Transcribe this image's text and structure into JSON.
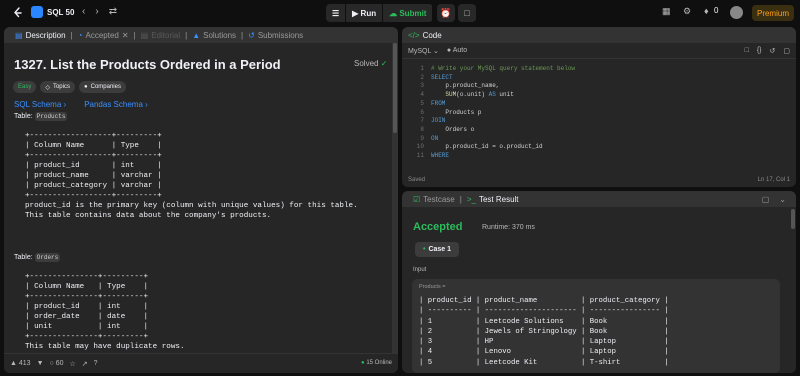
{
  "topbar": {
    "problem_list_label": "SQL 50",
    "run_label": "Run",
    "submit_label": "Submit",
    "streak_count": "0",
    "premium_label": "Premium"
  },
  "left_panel": {
    "tabs": [
      {
        "label": "Description"
      },
      {
        "label": "Accepted"
      },
      {
        "label": "Editorial"
      },
      {
        "label": "Solutions"
      },
      {
        "label": "Submissions"
      }
    ],
    "title": "1327. List the Products Ordered in a Period",
    "solved_label": "Solved",
    "chips": {
      "difficulty": "Easy",
      "topics": "Topics",
      "companies": "Companies"
    },
    "links": {
      "sql_schema": "SQL Schema",
      "pandas_schema": "Pandas Schema"
    },
    "table_label": "Table:",
    "products_table_name": "Products",
    "products_schema": "+------------------+---------+\n| Column Name      | Type    |\n+------------------+---------+\n| product_id       | int     |\n| product_name     | varchar |\n| product_category | varchar |\n+------------------+---------+\nproduct_id is the primary key (column with unique values) for this table.\nThis table contains data about the company's products.",
    "orders_table_name": "Orders",
    "orders_schema": "+---------------+---------+\n| Column Name   | Type    |\n+---------------+---------+\n| product_id    | int     |\n| order_date    | date    |\n| unit          | int     |\n+---------------+---------+\nThis table may have duplicate rows.",
    "footer": {
      "likes": "413",
      "comments": "60",
      "online": "15 Online"
    }
  },
  "code_panel": {
    "title": "Code",
    "language": "MySQL",
    "auto_label": "Auto",
    "line_numbers": [
      "1",
      "2",
      "3",
      "4",
      "5",
      "6",
      "7",
      "8",
      "9",
      "10",
      "11"
    ],
    "saved_label": "Saved",
    "cursor_pos": "Ln 17, Col 1"
  },
  "test_panel": {
    "tab_testcase": "Testcase",
    "tab_result": "Test Result",
    "status": "Accepted",
    "runtime": "Runtime: 370 ms",
    "case_label": "Case 1",
    "input_label": "Input",
    "products_label": "Products =",
    "products_table": "| product_id | product_name          | product_category |\n| ---------- | --------------------- | ---------------- |\n| 1          | Leetcode Solutions    | Book             |\n| 2          | Jewels of Stringology | Book             |\n| 3          | HP                    | Laptop           |\n| 4          | Lenovo                | Laptop           |\n| 5          | Leetcode Kit          | T-shirt          |"
  }
}
